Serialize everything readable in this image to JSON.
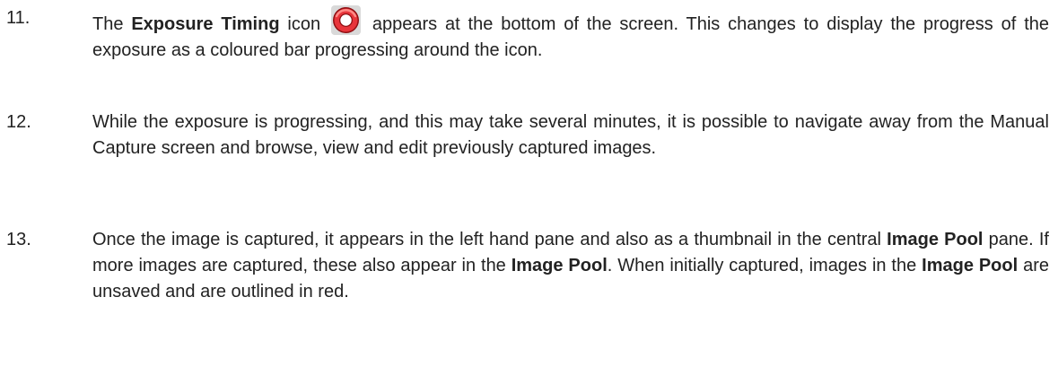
{
  "items": [
    {
      "number": "11.",
      "parts": [
        {
          "text": "The ",
          "bold": false
        },
        {
          "text": "Exposure Timing",
          "bold": true
        },
        {
          "text": " icon",
          "bold": false
        },
        {
          "icon": "exposure-timing-icon"
        },
        {
          "text": " appears at the bottom of the screen. This changes to display the progress of the exposure as a coloured bar progressing around the icon.",
          "bold": false
        }
      ]
    },
    {
      "number": "12.",
      "parts": [
        {
          "text": "While the exposure is progressing, and this may take several minutes, it is possible to navigate away from the Manual Capture screen and browse, view and edit previously captured images.",
          "bold": false
        }
      ]
    },
    {
      "number": "13.",
      "parts": [
        {
          "text": "Once the image is captured, it appears in the left hand pane and also as a thumbnail in the central ",
          "bold": false
        },
        {
          "text": "Image Pool",
          "bold": true
        },
        {
          "text": " pane. If more images are captured, these also appear in the ",
          "bold": false
        },
        {
          "text": "Image Pool",
          "bold": true
        },
        {
          "text": ". When initially captured, images in the ",
          "bold": false
        },
        {
          "text": "Image Pool",
          "bold": true
        },
        {
          "text": " are unsaved and are outlined in red.",
          "bold": false
        }
      ]
    }
  ],
  "icon_colors": {
    "ring_outer": "#8f0f12",
    "ring_main": "#e8353b",
    "ring_highlight": "#ff8a86",
    "background": "#d9d9d9"
  }
}
